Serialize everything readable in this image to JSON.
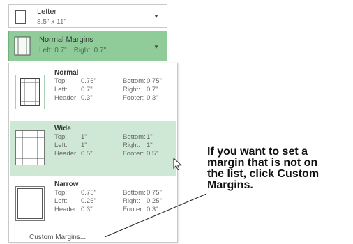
{
  "paper_size": {
    "name": "Letter",
    "dimensions": "8.5\" x 11\""
  },
  "current_margins": {
    "name": "Normal Margins",
    "left_label": "Left:",
    "left_value": "0.7\"",
    "right_label": "Right:",
    "right_value": "0.7\""
  },
  "labels": {
    "top": "Top:",
    "bottom": "Bottom:",
    "left": "Left:",
    "right": "Right:",
    "header": "Header:",
    "footer": "Footer:"
  },
  "options": [
    {
      "name": "Normal",
      "top": "0.75\"",
      "bottom": "0.75\"",
      "left": "0.7\"",
      "right": "0.7\"",
      "header": "0.3\"",
      "footer": "0.3\""
    },
    {
      "name": "Wide",
      "top": "1\"",
      "bottom": "1\"",
      "left": "1\"",
      "right": "1\"",
      "header": "0.5\"",
      "footer": "0.5\""
    },
    {
      "name": "Narrow",
      "top": "0.75\"",
      "bottom": "0.75\"",
      "left": "0.25\"",
      "right": "0.25\"",
      "header": "0.3\"",
      "footer": "0.3\""
    }
  ],
  "custom_margins_label": "Custom Margins...",
  "callout": {
    "line1": "If you want to set a",
    "line2": "margin that is not on",
    "line3": "the list, click Custom",
    "line4": "Margins."
  },
  "icons": [
    "page-icon",
    "margins-icon",
    "dropdown-arrow-icon",
    "mouse-pointer-icon"
  ]
}
